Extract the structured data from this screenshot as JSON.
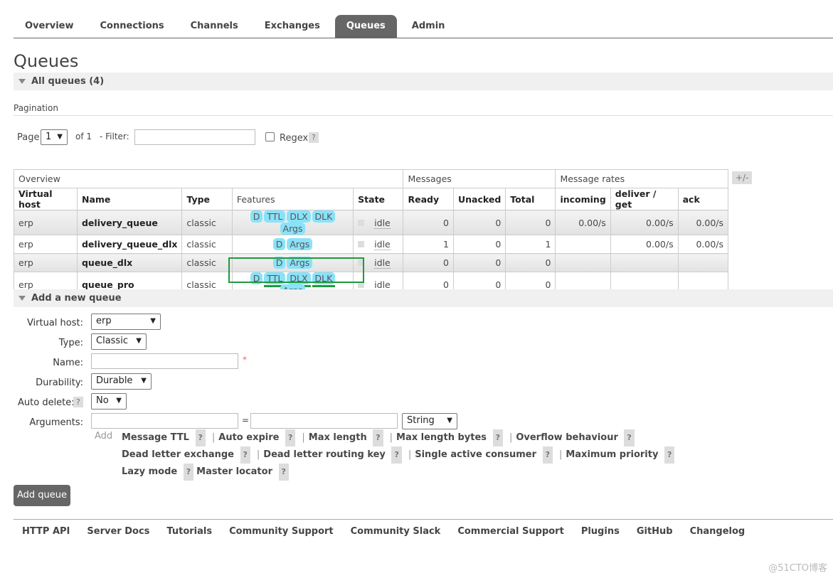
{
  "nav": {
    "tabs": [
      {
        "label": "Overview"
      },
      {
        "label": "Connections"
      },
      {
        "label": "Channels"
      },
      {
        "label": "Exchanges"
      },
      {
        "label": "Queues",
        "active": true
      },
      {
        "label": "Admin"
      }
    ]
  },
  "page_title": "Queues",
  "all_queues": "All queues (4)",
  "pagination": {
    "label": "Pagination",
    "page_label": "Page",
    "page_value": "1",
    "of": "of 1",
    "filter_label": "- Filter:",
    "filter_value": "",
    "regex_label": "Regex",
    "help": "?"
  },
  "table": {
    "groups": [
      "Overview",
      "Messages",
      "Message rates"
    ],
    "toggle": "+/-",
    "headers": [
      "Virtual host",
      "Name",
      "Type",
      "Features",
      "State",
      "Ready",
      "Unacked",
      "Total",
      "incoming",
      "deliver / get",
      "ack"
    ],
    "rows": [
      {
        "vhost": "erp",
        "name": "delivery_queue",
        "type": "classic",
        "features": [
          "D",
          "TTL",
          "DLX",
          "DLK",
          "Args"
        ],
        "state": "idle",
        "ready": "0",
        "unacked": "0",
        "total": "0",
        "incoming": "0.00/s",
        "deliver": "0.00/s",
        "ack": "0.00/s"
      },
      {
        "vhost": "erp",
        "name": "delivery_queue_dlx",
        "type": "classic",
        "features": [
          "D",
          "Args"
        ],
        "state": "idle",
        "ready": "1",
        "unacked": "0",
        "total": "1",
        "incoming": "",
        "deliver": "0.00/s",
        "ack": "0.00/s"
      },
      {
        "vhost": "erp",
        "name": "queue_dlx",
        "type": "classic",
        "features": [
          "D",
          "Args"
        ],
        "state": "idle",
        "ready": "0",
        "unacked": "0",
        "total": "0",
        "incoming": "",
        "deliver": "",
        "ack": ""
      },
      {
        "vhost": "erp",
        "name": "queue_pro",
        "type": "classic",
        "features": [
          "D",
          "TTL",
          "DLX",
          "DLK",
          "Args"
        ],
        "state": "idle",
        "ready": "0",
        "unacked": "0",
        "total": "0",
        "incoming": "",
        "deliver": "",
        "ack": ""
      }
    ]
  },
  "add_queue": {
    "title": "Add a new queue",
    "vhost_label": "Virtual host:",
    "vhost_value": "erp",
    "type_label": "Type:",
    "type_value": "Classic",
    "name_label": "Name:",
    "name_value": "",
    "required": "*",
    "durability_label": "Durability:",
    "durability_value": "Durable",
    "autodelete_label": "Auto delete:",
    "autodelete_value": "No",
    "arguments_label": "Arguments:",
    "eq": "=",
    "arg_type": "String",
    "add": "Add",
    "arg_links": [
      [
        "Message TTL",
        "Auto expire",
        "Max length",
        "Max length bytes",
        "Overflow behaviour"
      ],
      [
        "Dead letter exchange",
        "Dead letter routing key",
        "Single active consumer",
        "Maximum priority"
      ],
      [
        "Lazy mode",
        "Master locator"
      ]
    ],
    "submit": "Add queue"
  },
  "footer": [
    "HTTP API",
    "Server Docs",
    "Tutorials",
    "Community Support",
    "Community Slack",
    "Commercial Support",
    "Plugins",
    "GitHub",
    "Changelog"
  ],
  "watermark": "@51CTO博客",
  "colors": {
    "feature_badge": "#8ae2f8",
    "active_tab": "#666666",
    "highlight_box": "#1f9a3c"
  }
}
